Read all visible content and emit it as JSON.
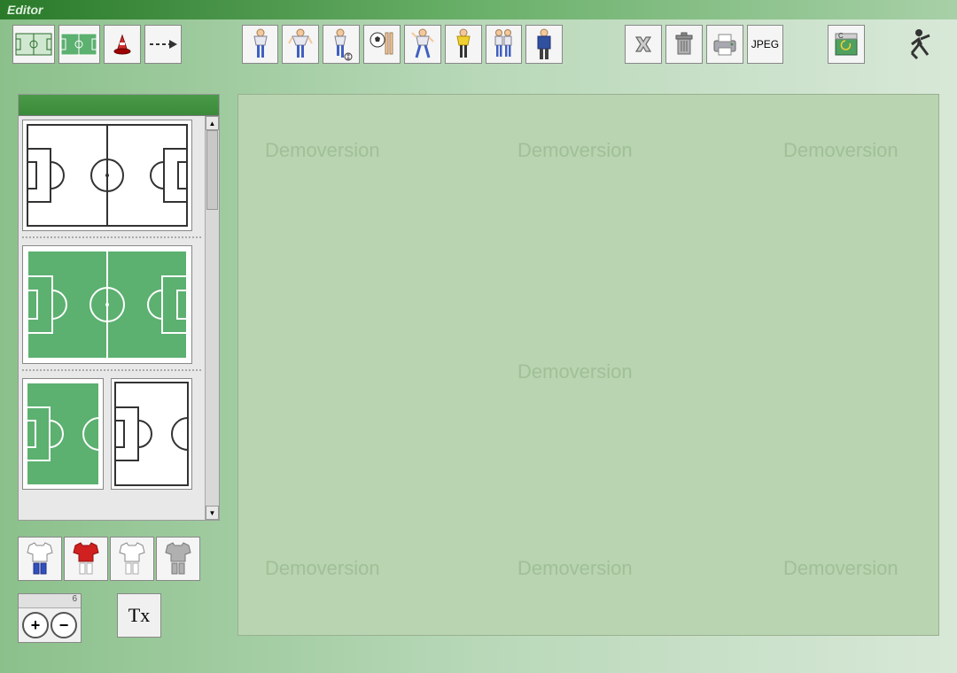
{
  "title": "Editor",
  "toolbar": {
    "field_outline": "field-outline",
    "field_green": "field-green",
    "cone": "cone",
    "arrow": "arrow",
    "players": [
      "player-blue",
      "player-red",
      "player-dribble",
      "player-ball",
      "player-run",
      "player-yellow",
      "player-pair",
      "player-goalie"
    ],
    "delete": "delete",
    "trash": "trash",
    "print": "print",
    "jpeg_label": "JPEG",
    "reload": "reload",
    "exit": "exit"
  },
  "kits": [
    "kit-blue-white",
    "kit-red",
    "kit-white",
    "kit-grey"
  ],
  "zoom": {
    "hint": "6",
    "plus": "+",
    "minus": "−"
  },
  "text_tool": "Tx",
  "watermark": "Demoversion",
  "colors": {
    "field_green": "#5cb070",
    "field_line_white": "#ffffff",
    "field_line_black": "#333333",
    "cone_red": "#d03030"
  }
}
